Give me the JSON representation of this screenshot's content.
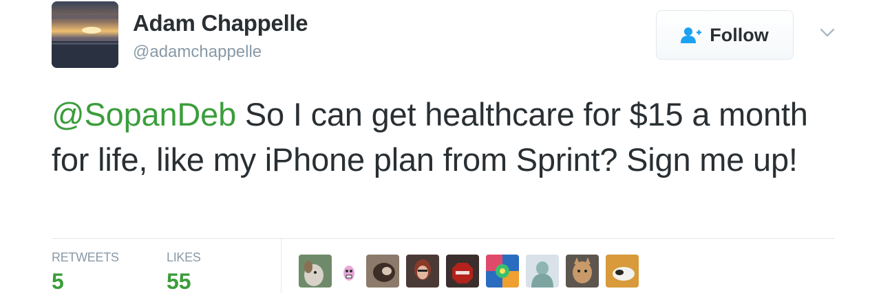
{
  "tweet": {
    "author": {
      "name": "Adam Chappelle",
      "handle": "@adamchappelle"
    },
    "follow_label": "Follow",
    "mention": "@SopanDeb",
    "body": " So I can get healthcare for $15 a month for life, like my iPhone plan from Sprint? Sign me up!",
    "stats": {
      "retweets_label": "RETWEETS",
      "retweets_count": "5",
      "likes_label": "LIKES",
      "likes_count": "55"
    },
    "liker_avatars": [
      "dog-avatar",
      "cartoon-avatar",
      "pet-avatar",
      "woman-avatar",
      "stop-sign-avatar",
      "colorful-art-avatar",
      "statue-avatar",
      "cat-avatar",
      "puppy-avatar"
    ]
  },
  "colors": {
    "accent_green": "#3b9d3b",
    "follow_icon_blue": "#1da1f2",
    "muted_gray": "#8899a6",
    "text_dark": "#292f33"
  }
}
